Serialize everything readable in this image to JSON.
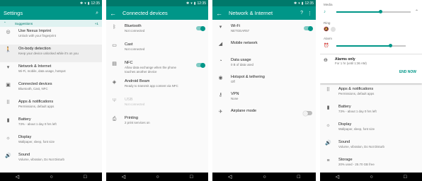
{
  "status_time": "12:35",
  "screen1": {
    "title": "Settings",
    "suggestions_label": "Suggestions",
    "suggestions_count": "+1",
    "items": [
      {
        "title": "Use Nexus Imprint",
        "sub": "Unlock with your fingerprint",
        "icon": "fingerprint-icon"
      },
      {
        "title": "On-body detection",
        "sub": "Keep your device unlocked while it's on you",
        "icon": "walk-icon"
      },
      {
        "title": "Network & Internet",
        "sub": "Wi-Fi, mobile, data usage, hotspot",
        "icon": "wifi-icon"
      },
      {
        "title": "Connected devices",
        "sub": "Bluetooth, Cast, NFC",
        "icon": "devices-icon"
      },
      {
        "title": "Apps & notifications",
        "sub": "Permissions, default apps",
        "icon": "apps-icon"
      },
      {
        "title": "Battery",
        "sub": "73% - about 1 day 0 hrs left",
        "icon": "battery-icon"
      },
      {
        "title": "Display",
        "sub": "Wallpaper, sleep, font size",
        "icon": "display-icon"
      },
      {
        "title": "Sound",
        "sub": "Volume, vibration, Do Not Disturb",
        "icon": "sound-icon"
      }
    ]
  },
  "screen2": {
    "title": "Connected devices",
    "items": [
      {
        "title": "Bluetooth",
        "sub": "Not connected",
        "icon": "bluetooth-icon",
        "toggle": "on"
      },
      {
        "title": "Cast",
        "sub": "Not connected",
        "icon": "cast-icon"
      },
      {
        "title": "NFC",
        "sub": "Allow data exchange when the phone",
        "sub2": "touches another device",
        "icon": "nfc-icon",
        "toggle": "on"
      },
      {
        "title": "Android Beam",
        "sub": "Ready to transmit app content via NFC",
        "icon": "beam-icon"
      },
      {
        "title": "USB",
        "sub": "Not connected",
        "icon": "usb-icon",
        "disabled": true
      },
      {
        "title": "Printing",
        "sub": "2 print services on",
        "icon": "print-icon"
      }
    ]
  },
  "screen3": {
    "title": "Network & Internet",
    "items": [
      {
        "title": "Wi-Fi",
        "sub": "NETGEAR57",
        "icon": "wifi-icon",
        "toggle": "on"
      },
      {
        "title": "Mobile network",
        "sub": "",
        "icon": "signal-icon"
      },
      {
        "title": "Data usage",
        "sub": "0 B of data used",
        "icon": "data-usage-icon"
      },
      {
        "title": "Hotspot & tethering",
        "sub": "Off",
        "icon": "hotspot-icon"
      },
      {
        "title": "VPN",
        "sub": "None",
        "icon": "vpn-key-icon"
      },
      {
        "title": "Airplane mode",
        "sub": "",
        "icon": "airplane-icon",
        "toggle": "off"
      }
    ]
  },
  "screen4": {
    "media_label": "Media",
    "ring_label": "Ring",
    "alarm_label": "Alarm",
    "media_level": 0.6,
    "alarm_level": 0.78,
    "alarms_only_title": "Alarms only",
    "alarms_only_sub": "For 1 hr (until 1:36 AM)",
    "end_now": "END NOW",
    "items": [
      {
        "title": "Apps & notifications",
        "sub": "Permissions, default apps",
        "icon": "apps-icon"
      },
      {
        "title": "Battery",
        "sub": "73% - about 1 day 0 hrs left",
        "icon": "battery-icon"
      },
      {
        "title": "Display",
        "sub": "Wallpaper, sleep, font size",
        "icon": "display-icon"
      },
      {
        "title": "Sound",
        "sub": "Volume, vibration, Do Not Disturb",
        "icon": "sound-icon"
      },
      {
        "title": "Storage",
        "sub": "20% used - 25.70 GB free",
        "icon": "storage-icon"
      }
    ]
  }
}
